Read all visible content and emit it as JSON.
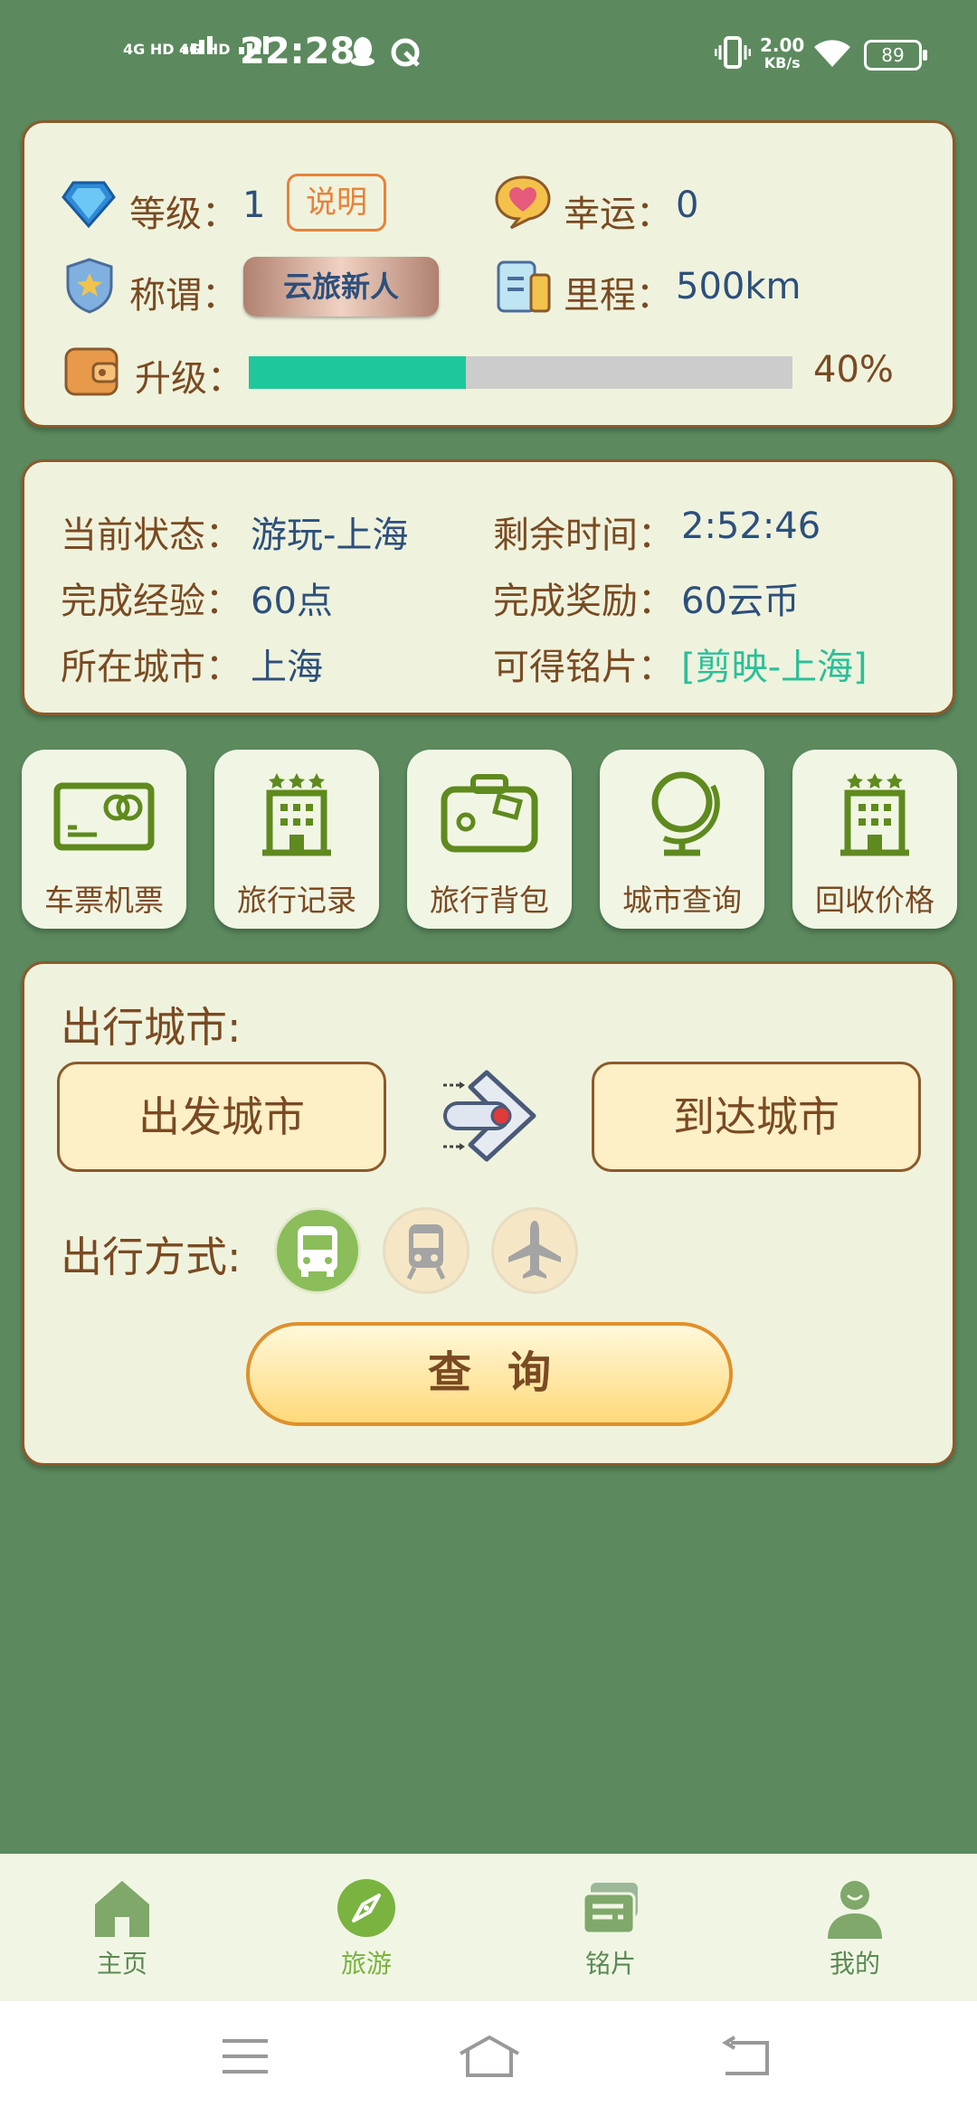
{
  "status_bar": {
    "sim1": "4G HD",
    "sim2": "4G HD",
    "time": "22:28",
    "net_speed_value": "2.00",
    "net_speed_unit": "KB/s",
    "battery": "89"
  },
  "profile": {
    "level_label": "等级：",
    "level_value": "1",
    "explain_button": "说明",
    "luck_label": "幸运：",
    "luck_value": "0",
    "title_label": "称谓：",
    "title_badge": "云旅新人",
    "mileage_label": "里程：",
    "mileage_value": "500km",
    "upgrade_label": "升级：",
    "upgrade_progress": 0.4,
    "upgrade_percent": "40%"
  },
  "status": {
    "state_label": "当前状态：",
    "state_value": "游玩-上海",
    "remain_label": "剩余时间：",
    "remain_value": "2:52:46",
    "exp_label": "完成经验：",
    "exp_value": "60点",
    "reward_label": "完成奖励：",
    "reward_value": "60云币",
    "city_label": "所在城市：",
    "city_value": "上海",
    "card_label": "可得铭片：",
    "card_value": "[剪映-上海]"
  },
  "shortcuts": [
    {
      "label": "车票机票",
      "icon": "ticket-icon"
    },
    {
      "label": "旅行记录",
      "icon": "hotel-icon"
    },
    {
      "label": "旅行背包",
      "icon": "suitcase-icon"
    },
    {
      "label": "城市查询",
      "icon": "globe-icon"
    },
    {
      "label": "回收价格",
      "icon": "hotel-icon"
    }
  ],
  "trip": {
    "city_title": "出行城市:",
    "from_button": "出发城市",
    "to_button": "到达城市",
    "mode_title": "出行方式:",
    "modes": [
      "bus-icon",
      "train-icon",
      "plane-icon"
    ],
    "selected_mode": "bus-icon",
    "query_button": "查询"
  },
  "bottom_nav": {
    "items": [
      {
        "label": "主页",
        "icon": "home-icon"
      },
      {
        "label": "旅游",
        "icon": "compass-icon"
      },
      {
        "label": "铭片",
        "icon": "cards-icon"
      },
      {
        "label": "我的",
        "icon": "user-icon"
      }
    ],
    "active": "旅游"
  },
  "colors": {
    "background": "#5c8a5e",
    "card": "#eff3dd",
    "border": "#8b5a2b",
    "label": "#7a4a22",
    "value": "#2d4f7c",
    "accent": "#2bbf9a",
    "nav_active": "#7ab33f"
  }
}
